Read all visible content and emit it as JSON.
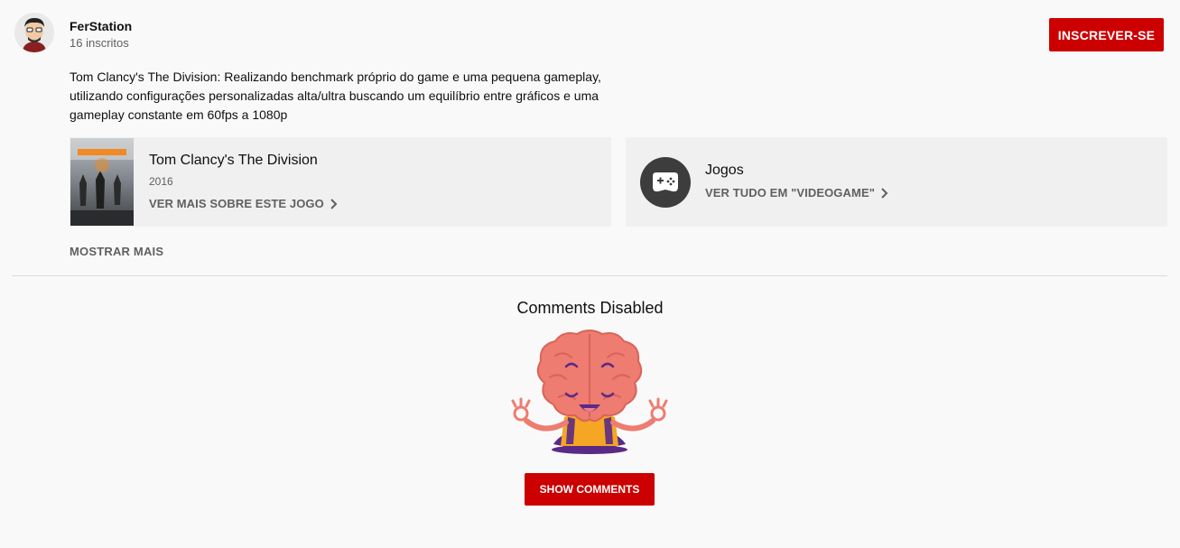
{
  "channel": {
    "name": "FerStation",
    "subscribers": "16 inscritos",
    "subscribe_label": "INSCREVER-SE"
  },
  "description": "Tom Clancy's The Division: Realizando benchmark próprio do game e uma pequena gameplay, utilizando configurações personalizadas alta/ultra buscando um equilíbrio entre gráficos e uma gameplay constante em 60fps a 1080p",
  "game_card": {
    "title": "Tom Clancy's The Division",
    "year": "2016",
    "link": "VER MAIS SOBRE ESTE JOGO",
    "thumb_text": "THE DIVISION"
  },
  "category_card": {
    "title": "Jogos",
    "link": "VER TUDO EM \"VIDEOGAME\""
  },
  "show_more": "MOSTRAR MAIS",
  "comments": {
    "title": "Comments Disabled",
    "button_label": "SHOW COMMENTS"
  },
  "colors": {
    "accent": "#cc0000",
    "background": "#f9f9f9",
    "card": "#f0f0f0",
    "brain": "#ee7c70",
    "shirt": "#f5a623",
    "pants": "#5b2a86"
  },
  "icons": [
    "avatar",
    "game-thumbnail",
    "gamepad-icon",
    "chevron-right-icon",
    "brain-mascot"
  ]
}
